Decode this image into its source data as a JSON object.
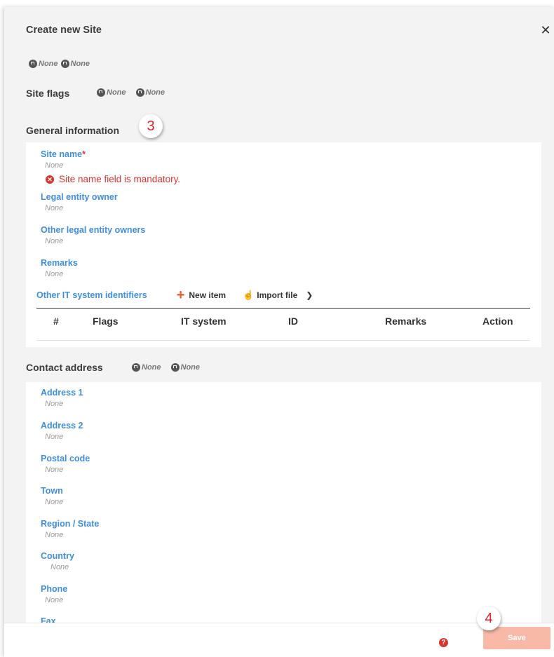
{
  "dialog": {
    "title": "Create new Site",
    "close_icon": "close-icon"
  },
  "top_flags": [
    {
      "label": "None",
      "icon": "flag-icon"
    },
    {
      "label": "None",
      "icon": "flag-icon"
    }
  ],
  "site_flags": {
    "label": "Site flags",
    "flags": [
      {
        "label": "None",
        "icon": "flag-icon"
      },
      {
        "label": "None",
        "icon": "flag-icon"
      }
    ]
  },
  "general": {
    "title": "General information",
    "callout": "3",
    "fields": [
      {
        "label": "Site name",
        "required_mark": "*",
        "value": "None"
      },
      {
        "label": "Legal entity owner",
        "value": "None"
      },
      {
        "label": "Other legal entity owners",
        "value": "None"
      },
      {
        "label": "Remarks",
        "value": "None"
      }
    ],
    "error": "Site name field is mandatory.",
    "identifiers": {
      "label": "Other IT system identifiers",
      "new_item": "New item",
      "import_file": "Import file",
      "columns": [
        "#",
        "Flags",
        "IT system",
        "ID",
        "Remarks",
        "Action"
      ]
    }
  },
  "contact": {
    "title": "Contact address",
    "flags": [
      {
        "label": "None",
        "icon": "flag-icon"
      },
      {
        "label": "None",
        "icon": "flag-icon"
      }
    ],
    "fields": [
      {
        "label": "Address 1",
        "value": "None"
      },
      {
        "label": "Address 2",
        "value": "None"
      },
      {
        "label": "Postal code",
        "value": "None"
      },
      {
        "label": "Town",
        "value": "None"
      },
      {
        "label": "Region / State",
        "value": "None"
      },
      {
        "label": "Country",
        "value": "None"
      },
      {
        "label": "Phone",
        "value": "None"
      },
      {
        "label": "Fax",
        "value": ""
      }
    ]
  },
  "footer": {
    "save_label": "Save",
    "callout": "4",
    "help_icon": "help-icon"
  },
  "colors": {
    "accent": "#3f8ee0",
    "error": "#d9352f",
    "save_disabled": "#f8b9a6",
    "action_orange": "#e8572c"
  }
}
